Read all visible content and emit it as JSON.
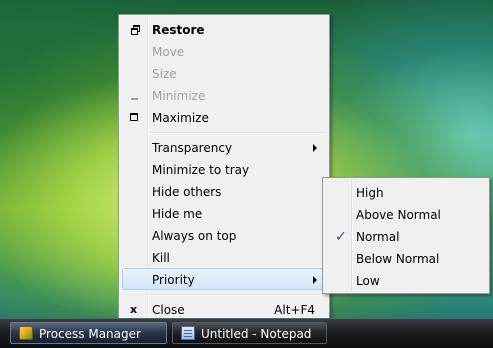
{
  "context_menu": {
    "items": [
      {
        "label": "Restore"
      },
      {
        "label": "Move"
      },
      {
        "label": "Size"
      },
      {
        "label": "Minimize"
      },
      {
        "label": "Maximize"
      },
      {
        "label": "Transparency"
      },
      {
        "label": "Minimize to tray"
      },
      {
        "label": "Hide others"
      },
      {
        "label": "Hide me"
      },
      {
        "label": "Always on top"
      },
      {
        "label": "Kill"
      },
      {
        "label": "Priority"
      },
      {
        "label": "Close",
        "shortcut": "Alt+F4"
      }
    ]
  },
  "priority_submenu": {
    "items": [
      {
        "label": "High"
      },
      {
        "label": "Above Normal"
      },
      {
        "label": "Normal",
        "checked": true
      },
      {
        "label": "Below Normal"
      },
      {
        "label": "Low"
      }
    ]
  },
  "taskbar": {
    "tasks": [
      {
        "label": "Process Manager",
        "icon": "process-manager-icon",
        "active": true
      },
      {
        "label": "Untitled - Notepad",
        "icon": "notepad-icon",
        "active": false
      }
    ]
  }
}
